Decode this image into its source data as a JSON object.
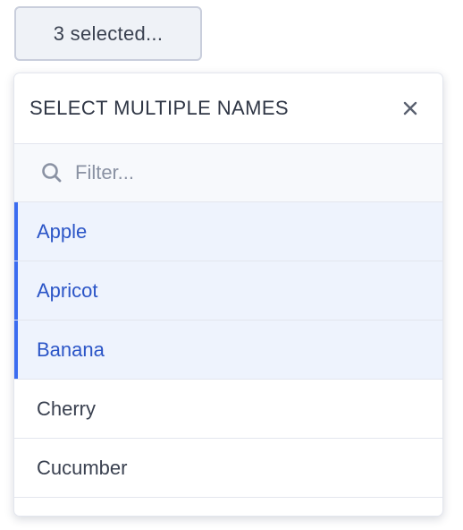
{
  "trigger": {
    "label": "3 selected..."
  },
  "panel": {
    "title": "SELECT MULTIPLE NAMES",
    "close_icon": "close-icon",
    "filter": {
      "value": "",
      "placeholder": "Filter...",
      "icon": "search-icon"
    },
    "options": [
      {
        "label": "Apple",
        "selected": true
      },
      {
        "label": "Apricot",
        "selected": true
      },
      {
        "label": "Banana",
        "selected": true
      },
      {
        "label": "Cherry",
        "selected": false
      },
      {
        "label": "Cucumber",
        "selected": false
      }
    ]
  },
  "colors": {
    "accent": "#3b6cf0",
    "selected_text": "#2b55c7",
    "selected_bg": "#eef3fd",
    "text": "#3a4150",
    "border": "#e3e6ee"
  }
}
